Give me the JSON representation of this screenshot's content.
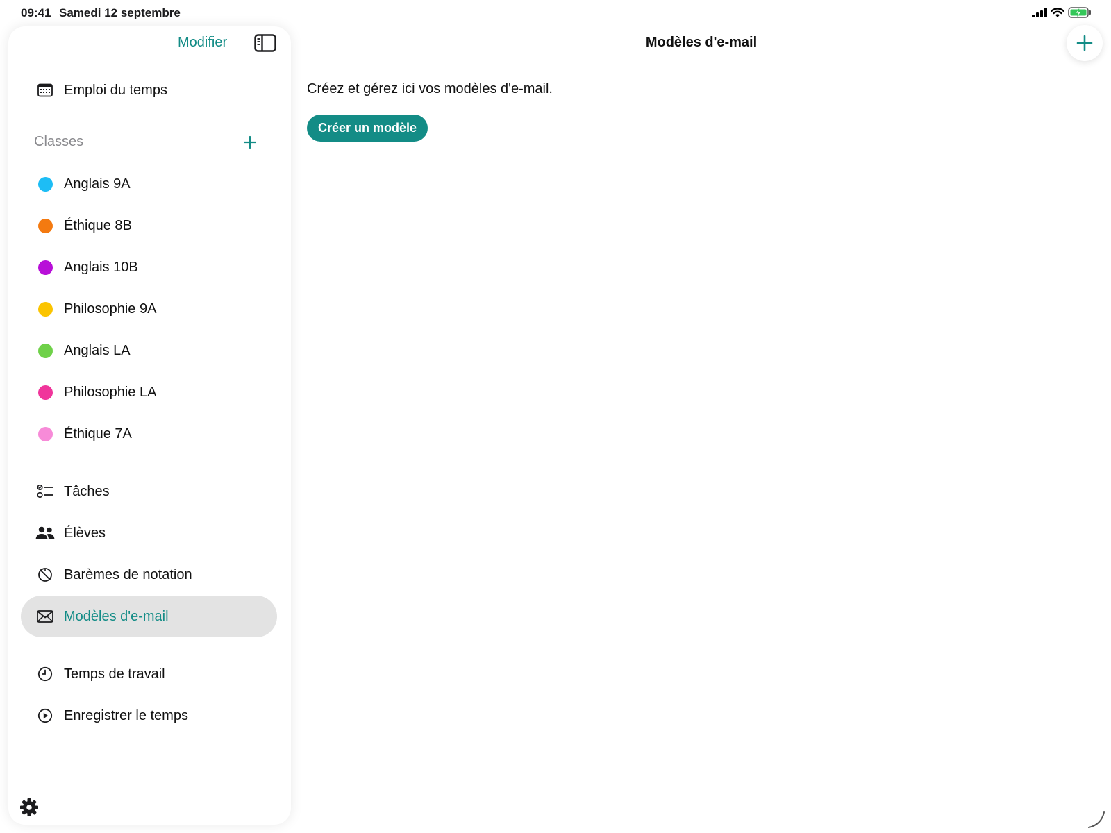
{
  "status_bar": {
    "time": "09:41",
    "date": "Samedi 12 septembre"
  },
  "sidebar": {
    "edit_label": "Modifier",
    "schedule_label": "Emploi du temps",
    "classes_header": "Classes",
    "classes": [
      {
        "label": "Anglais 9A",
        "color": "#1dbdf5"
      },
      {
        "label": "Éthique 8B",
        "color": "#f47a10"
      },
      {
        "label": "Anglais 10B",
        "color": "#b80fd8"
      },
      {
        "label": "Philosophie 9A",
        "color": "#fbc400"
      },
      {
        "label": "Anglais LA",
        "color": "#6fd149"
      },
      {
        "label": "Philosophie LA",
        "color": "#f0359b"
      },
      {
        "label": "Éthique 7A",
        "color": "#f78bd8"
      }
    ],
    "tools": [
      {
        "label": "Tâches",
        "icon": "checklist-icon"
      },
      {
        "label": "Élèves",
        "icon": "people-icon"
      },
      {
        "label": "Barèmes de notation",
        "icon": "grading-scale-icon"
      },
      {
        "label": "Modèles d'e-mail",
        "icon": "envelope-icon",
        "active": true
      }
    ],
    "time_items": [
      {
        "label": "Temps de travail",
        "icon": "clock-icon"
      },
      {
        "label": "Enregistrer le temps",
        "icon": "play-circle-icon"
      }
    ]
  },
  "main": {
    "title": "Modèles d'e-mail",
    "intro": "Créez et gérez ici vos modèles d'e-mail.",
    "create_button": "Créer un modèle"
  },
  "colors": {
    "accent": "#138c86",
    "active_bg": "#e3e3e3"
  }
}
